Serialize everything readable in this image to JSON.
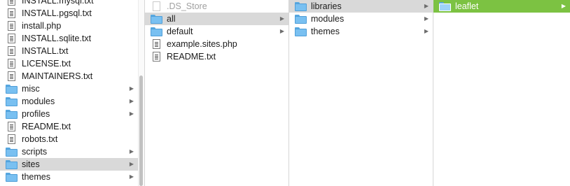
{
  "columns": [
    {
      "items": [
        {
          "name": "INSTALL.mysql.txt",
          "kind": "file"
        },
        {
          "name": "INSTALL.pgsql.txt",
          "kind": "file"
        },
        {
          "name": "install.php",
          "kind": "file"
        },
        {
          "name": "INSTALL.sqlite.txt",
          "kind": "file"
        },
        {
          "name": "INSTALL.txt",
          "kind": "file"
        },
        {
          "name": "LICENSE.txt",
          "kind": "file"
        },
        {
          "name": "MAINTAINERS.txt",
          "kind": "file"
        },
        {
          "name": "misc",
          "kind": "folder"
        },
        {
          "name": "modules",
          "kind": "folder"
        },
        {
          "name": "profiles",
          "kind": "folder"
        },
        {
          "name": "README.txt",
          "kind": "file"
        },
        {
          "name": "robots.txt",
          "kind": "file"
        },
        {
          "name": "scripts",
          "kind": "folder"
        },
        {
          "name": "sites",
          "kind": "folder",
          "selected": "gray"
        },
        {
          "name": "themes",
          "kind": "folder"
        }
      ]
    },
    {
      "items": [
        {
          "name": ".DS_Store",
          "kind": "hidden-file"
        },
        {
          "name": "all",
          "kind": "folder",
          "selected": "gray"
        },
        {
          "name": "default",
          "kind": "folder"
        },
        {
          "name": "example.sites.php",
          "kind": "file"
        },
        {
          "name": "README.txt",
          "kind": "file"
        }
      ]
    },
    {
      "items": [
        {
          "name": "libraries",
          "kind": "folder",
          "selected": "gray"
        },
        {
          "name": "modules",
          "kind": "folder"
        },
        {
          "name": "themes",
          "kind": "folder"
        }
      ]
    },
    {
      "items": [
        {
          "name": "leaflet",
          "kind": "folder",
          "selected": "green"
        }
      ]
    }
  ],
  "icons": {
    "folder": "folder-icon",
    "file": "document-icon",
    "chevron": "chevron-right-icon"
  },
  "colors": {
    "selection_active": "#7cc242",
    "selection_inactive": "#d9d9d9",
    "folder": "#79c0f1"
  }
}
